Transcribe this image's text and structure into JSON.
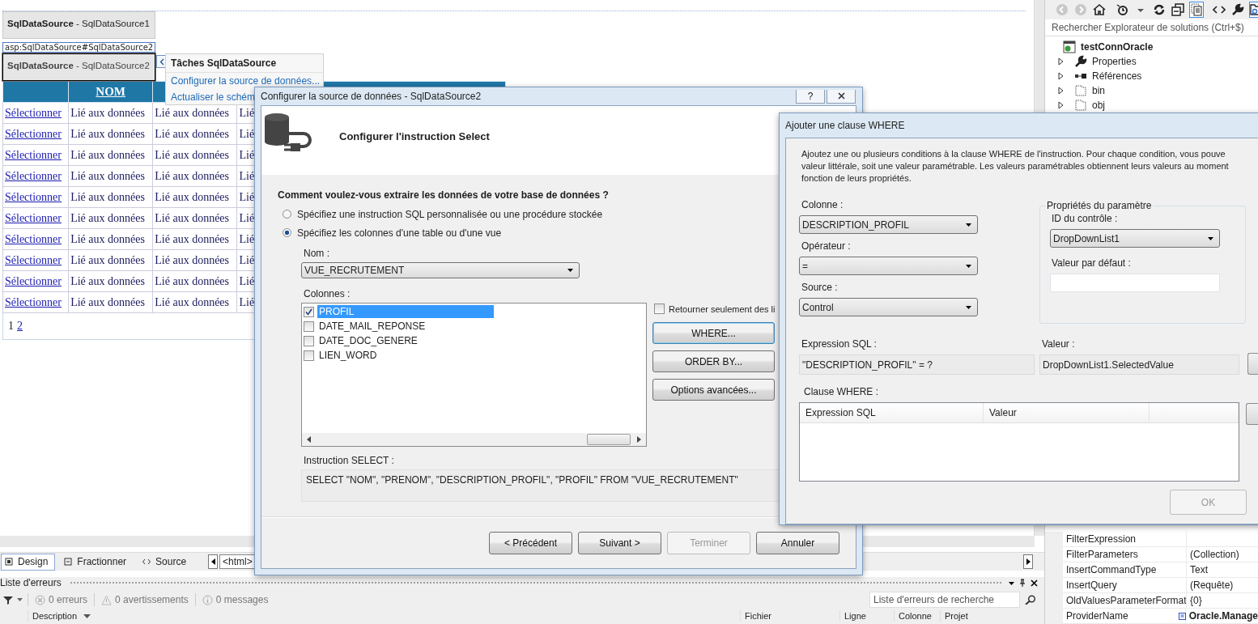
{
  "designer": {
    "components": [
      {
        "label": "**SqlDataSource** - SqlDataSource1",
        "selected": false
      },
      {
        "label": "**SqlDataSource** - SqlDataSource2",
        "selected": true
      }
    ],
    "tag_label": "asp:SqlDataSource#SqlDataSource2",
    "task_menu": {
      "title": "Tâches SqlDataSource",
      "items": [
        "Configurer la source de données...",
        "Actualiser le schém"
      ]
    },
    "grid": {
      "columns": [
        {
          "kind": "select"
        },
        {
          "kind": "bound",
          "label": "NOM"
        },
        {
          "kind": "bound"
        },
        {
          "kind": "bound"
        }
      ],
      "rows": [
        [
          "Sélectionner",
          "Lié aux données",
          "Lié aux données",
          "Lié"
        ],
        [
          "Sélectionner",
          "Lié aux données",
          "Lié aux données",
          "Lié"
        ],
        [
          "Sélectionner",
          "Lié aux données",
          "Lié aux données",
          "Lié"
        ],
        [
          "Sélectionner",
          "Lié aux données",
          "Lié aux données",
          "Lié"
        ],
        [
          "Sélectionner",
          "Lié aux données",
          "Lié aux données",
          "Lié"
        ],
        [
          "Sélectionner",
          "Lié aux données",
          "Lié aux données",
          "Lié"
        ],
        [
          "Sélectionner",
          "Lié aux données",
          "Lié aux données",
          "Lié"
        ],
        [
          "Sélectionner",
          "Lié aux données",
          "Lié aux données",
          "Lié"
        ],
        [
          "Sélectionner",
          "Lié aux données",
          "Lié aux données",
          "Lié"
        ],
        [
          "Sélectionner",
          "Lié aux données",
          "Lié aux données",
          "Lié"
        ]
      ],
      "pager": [
        {
          "label": "1",
          "selected": true
        },
        {
          "label": "2",
          "selected": false
        }
      ]
    },
    "view_tabs": [
      {
        "label": "Design",
        "kind": "design",
        "selected": true
      },
      {
        "label": "Fractionner",
        "kind": "split",
        "selected": false
      },
      {
        "label": "Source",
        "kind": "source",
        "selected": false
      }
    ],
    "breadcrumb": [
      "<html>"
    ]
  },
  "error_list": {
    "title": "Liste d'erreurs",
    "filters": [
      {
        "kind": "error",
        "label": "0 erreurs"
      },
      {
        "kind": "warning",
        "label": "0 avertissements"
      },
      {
        "kind": "message",
        "label": "0 messages"
      }
    ],
    "search": {
      "placeholder": "Liste d'erreurs de recherche"
    },
    "columns": [
      "Description",
      "Fichier",
      "Ligne",
      "Colonne",
      "Projet"
    ]
  },
  "solution_explorer": {
    "toolbar": [
      {
        "kind": "back",
        "on": false
      },
      {
        "kind": "forward",
        "on": false
      },
      {
        "kind": "home",
        "on": false
      },
      {
        "kind": "history",
        "on": false
      },
      {
        "kind": "caret",
        "on": false
      },
      {
        "kind": "refresh",
        "on": false
      },
      {
        "kind": "collapse",
        "on": false
      },
      {
        "kind": "show_all",
        "on": true
      },
      {
        "kind": "code",
        "on": false
      },
      {
        "kind": "properties",
        "on": false
      },
      {
        "kind": "preview",
        "on": true
      }
    ],
    "search": {
      "placeholder": "Rechercher Explorateur de solutions (Ctrl+$)"
    },
    "tree": [
      {
        "label": "testConnOracle",
        "kind": "project",
        "children": [
          {
            "label": "Properties",
            "kind": "properties",
            "expanded": false
          },
          {
            "label": "Références",
            "kind": "references",
            "expanded": false
          },
          {
            "label": "bin",
            "kind": "folder",
            "expanded": false
          },
          {
            "label": "obj",
            "kind": "folder",
            "expanded": false
          }
        ]
      }
    ]
  },
  "properties": [
    {
      "name": "FilterExpression",
      "modified": false
    },
    {
      "name": "FilterParameters",
      "value": "(Collection)",
      "modified": false
    },
    {
      "name": "InsertCommandType",
      "value": "Text",
      "modified": false
    },
    {
      "name": "InsertQuery",
      "value": "(Requête)",
      "modified": false
    },
    {
      "name": "OldValuesParameterFormat",
      "value": "{0}",
      "modified": false
    },
    {
      "name": "ProviderName",
      "value": "Oracle.Manage",
      "modified": true
    }
  ],
  "configure_dialog": {
    "title": "Configurer la source de données - SqlDataSource2",
    "help_button": "?",
    "heading": "Configurer l'instruction Select",
    "question": "Comment voulez-vous extraire les données de votre base de données ?",
    "options": [
      {
        "label": "Spécifiez une instruction SQL personnalisée ou une procédure stockée",
        "selected": false
      },
      {
        "label": "Spécifiez les colonnes d'une table ou d'une vue",
        "selected": true
      }
    ],
    "name_label": "Nom :",
    "name_value": "VUE_RECRUTEMENT",
    "columns_label": "Colonnes :",
    "columns": [
      {
        "label": "PROFIL",
        "checked": true,
        "selected": true
      },
      {
        "label": "DATE_MAIL_REPONSE",
        "checked": false,
        "selected": false
      },
      {
        "label": "DATE_DOC_GENERE",
        "checked": false,
        "selected": false
      },
      {
        "label": "LIEN_WORD",
        "checked": false,
        "selected": false
      }
    ],
    "distinct": {
      "label": "Retourner seulement des li",
      "checked": false
    },
    "side_buttons": [
      {
        "label": "WHERE...",
        "focused": true
      },
      {
        "label": "ORDER BY...",
        "focused": false
      },
      {
        "label": "Options avancées...",
        "focused": false
      }
    ],
    "sql_label": "Instruction SELECT :",
    "sql": "SELECT \"NOM\", \"PRENOM\", \"DESCRIPTION_PROFIL\", \"PROFIL\" FROM \"VUE_RECRUTEMENT\"",
    "buttons": [
      {
        "label": "< Précédent",
        "disabled": false
      },
      {
        "label": "Suivant >",
        "disabled": false
      },
      {
        "label": "Terminer",
        "disabled": true
      },
      {
        "label": "Annuler",
        "disabled": false
      }
    ]
  },
  "where_dialog": {
    "title": "Ajouter une clause WHERE",
    "intro": "Ajoutez une ou plusieurs conditions à la clause WHERE de l'instruction. Pour chaque condition, vous pouve\nvaleur littérale, soit une valeur paramétrable. Les valeurs paramétrables obtiennent leurs valeurs au moment\nfonction de leurs propriétés.",
    "column": {
      "label": "Colonne :",
      "value": "DESCRIPTION_PROFIL"
    },
    "operator": {
      "label": "Opérateur :",
      "value": "="
    },
    "source": {
      "label": "Source :",
      "value": "Control"
    },
    "parameter_group": {
      "title": "Propriétés du paramètre",
      "control_id": {
        "label": "ID du contrôle :",
        "value": "DropDownList1"
      },
      "default_value": {
        "label": "Valeur par défaut :"
      }
    },
    "expression": {
      "label": "Expression SQL :",
      "value": "\"DESCRIPTION_PROFIL\" = ?"
    },
    "value": {
      "label": "Valeur :",
      "value": "DropDownList1.SelectedValue"
    },
    "clause_label": "Clause WHERE :",
    "clause_columns": [
      "Expression SQL",
      "Valeur"
    ],
    "ok": {
      "label": "OK",
      "disabled": true
    }
  }
}
